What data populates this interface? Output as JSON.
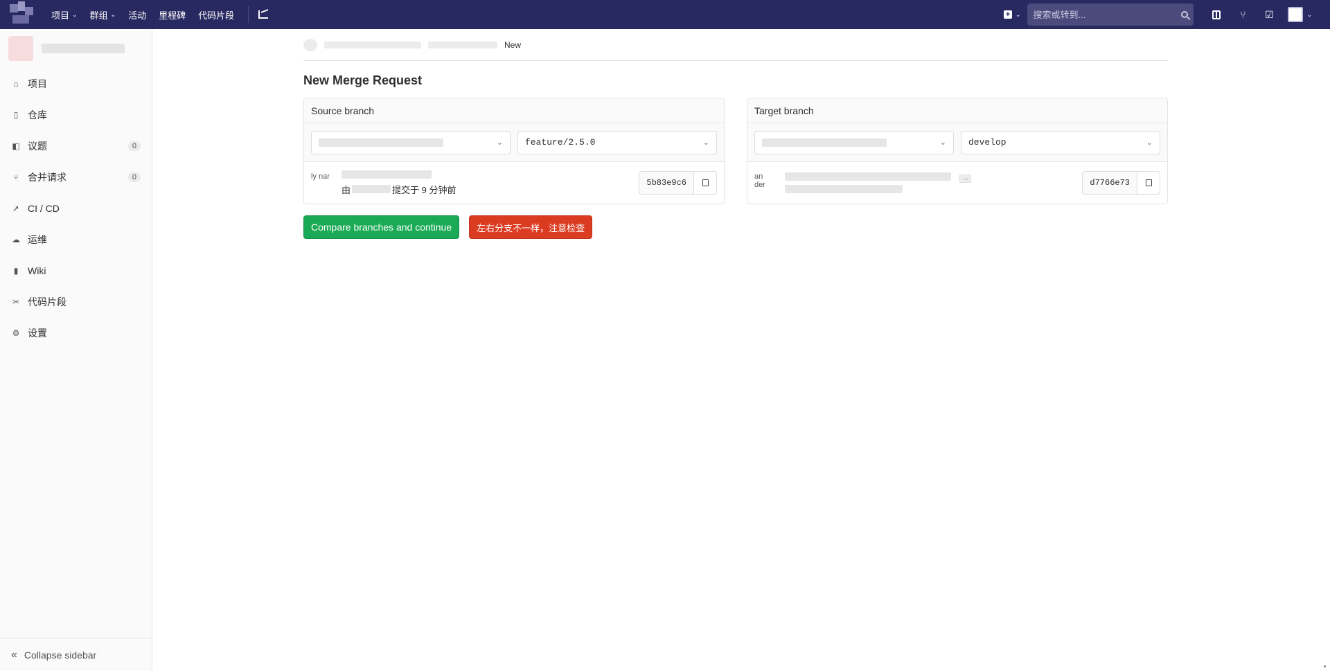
{
  "navbar": {
    "links": [
      {
        "label": "项目",
        "has_dropdown": true
      },
      {
        "label": "群组",
        "has_dropdown": true
      },
      {
        "label": "活动",
        "has_dropdown": false
      },
      {
        "label": "里程碑",
        "has_dropdown": false
      },
      {
        "label": "代码片段",
        "has_dropdown": false
      }
    ],
    "chart_icon": "chart-icon",
    "search_placeholder": "搜索或转到...",
    "chevron": "⌄"
  },
  "sidebar": {
    "items": [
      {
        "label": "项目",
        "icon": "home-icon",
        "glyph": "⌂",
        "count": null
      },
      {
        "label": "仓库",
        "icon": "file-icon",
        "glyph": "▯",
        "count": null
      },
      {
        "label": "议题",
        "icon": "issues-icon",
        "glyph": "◧",
        "count": "0"
      },
      {
        "label": "合并请求",
        "icon": "merge-request-icon",
        "glyph": "⑂",
        "count": "0"
      },
      {
        "label": "CI / CD",
        "icon": "rocket-icon",
        "glyph": "➚",
        "count": null
      },
      {
        "label": "运维",
        "icon": "cloud-gear-icon",
        "glyph": "☁",
        "count": null
      },
      {
        "label": "Wiki",
        "icon": "book-icon",
        "glyph": "▮",
        "count": null
      },
      {
        "label": "代码片段",
        "icon": "scissors-icon",
        "glyph": "✂",
        "count": null
      },
      {
        "label": "设置",
        "icon": "gear-icon",
        "glyph": "⚙",
        "count": null
      }
    ],
    "collapse_label": "Collapse sidebar",
    "collapse_glyph": "«"
  },
  "breadcrumb": {
    "current": "New"
  },
  "page": {
    "title": "New Merge Request"
  },
  "source": {
    "heading": "Source branch",
    "branch": "feature/2.5.0",
    "avatar_alt": "ly nar",
    "commit_meta_prefix": "由",
    "commit_meta_suffix": "提交于 9 分钟前",
    "sha": "5b83e9c6"
  },
  "target": {
    "heading": "Target branch",
    "branch": "develop",
    "avatar_alt": "an der",
    "ellipsis": "···",
    "sha": "d7766e73"
  },
  "actions": {
    "compare_label": "Compare branches and continue",
    "warning_label": "左右分支不一样，注意检查"
  },
  "colors": {
    "navbar_bg": "#292961",
    "green": "#1aaa55",
    "red": "#db3b21"
  }
}
